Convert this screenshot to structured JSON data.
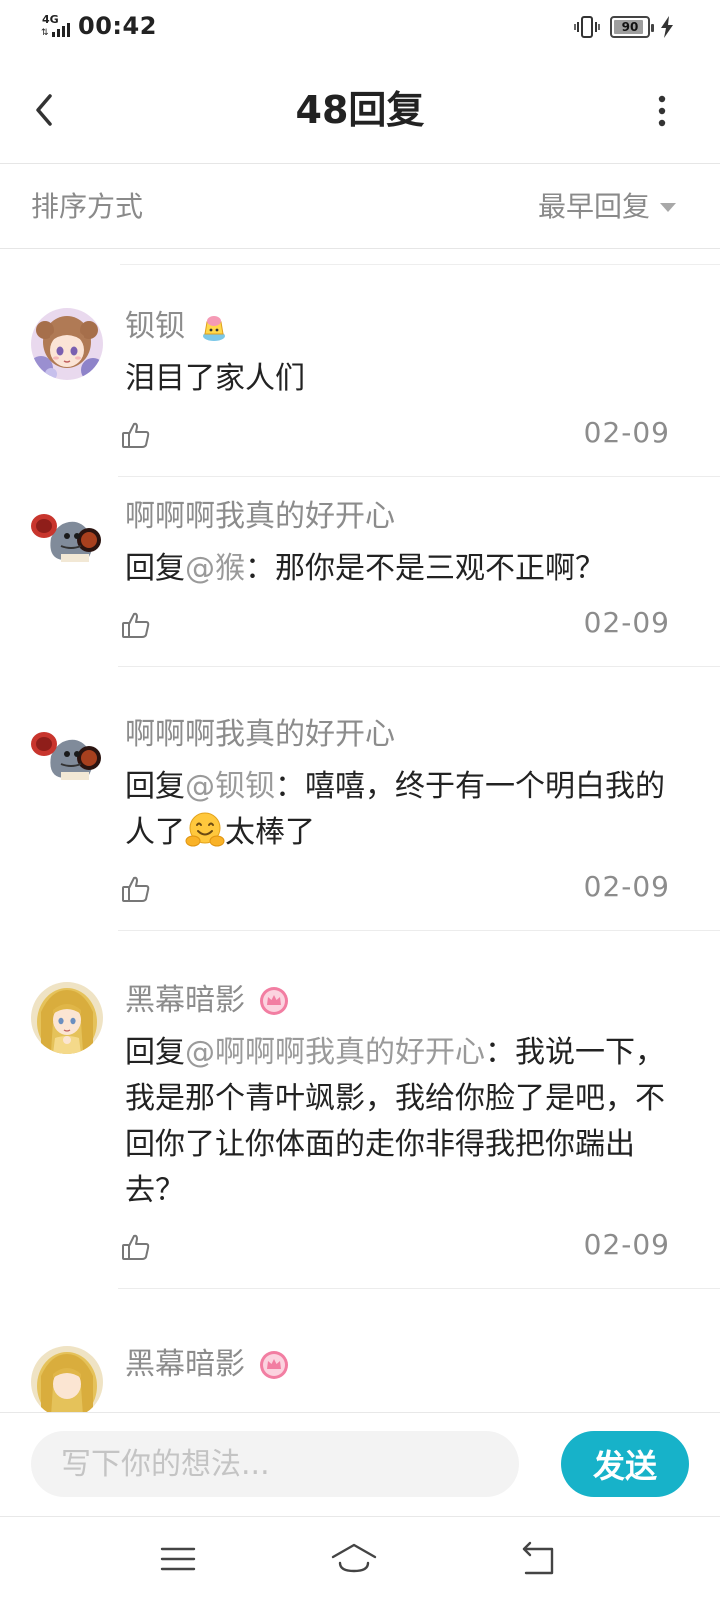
{
  "status_bar": {
    "network": "4G",
    "time": "00:42",
    "battery": "90",
    "battery_level": 0.9
  },
  "header": {
    "title": "48回复"
  },
  "sort": {
    "label": "排序方式",
    "value": "最早回复"
  },
  "comments": [
    {
      "username": "钡钡",
      "prefix": "",
      "mention": "",
      "text": "泪目了家人们",
      "date": "02-09"
    },
    {
      "username": "啊啊啊我真的好开心",
      "prefix": "回复",
      "mention": "@猴",
      "text": "：那你是不是三观不正啊？",
      "date": "02-09"
    },
    {
      "username": "啊啊啊我真的好开心",
      "prefix": "回复",
      "mention": "@钡钡",
      "text": "：嘻嘻，终于有一个明白我的人了",
      "text_after": "太棒了",
      "date": "02-09"
    },
    {
      "username": "黑幕暗影",
      "prefix": "回复",
      "mention": "@啊啊啊我真的好开心",
      "text": "：我说一下，我是那个青叶飒影，我给你脸了是吧，不回你了让你体面的走你非得我把你踹出去？",
      "date": "02-09"
    },
    {
      "username": "黑幕暗影"
    }
  ],
  "composer": {
    "placeholder": "写下你的想法...",
    "send_label": "发送"
  },
  "colors": {
    "accent": "#17b2c9",
    "username": "#8c8c8c",
    "mention": "#9a9a9a"
  }
}
